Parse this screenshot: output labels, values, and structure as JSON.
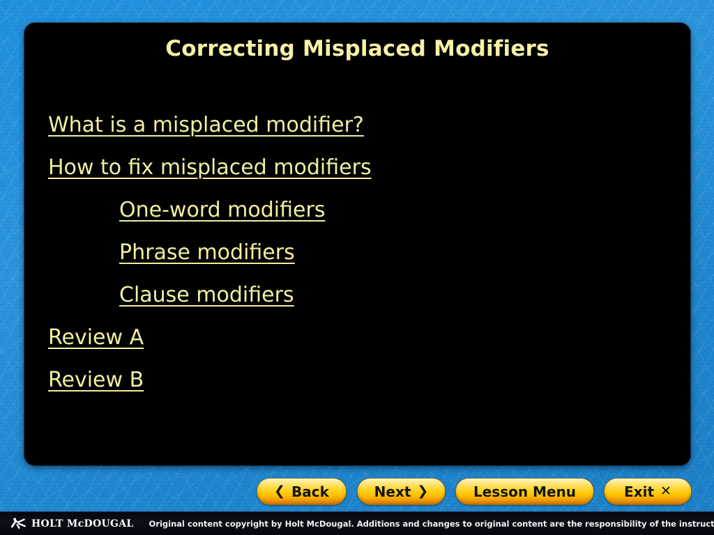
{
  "slide": {
    "title": "Correcting Misplaced Modifiers",
    "links": [
      {
        "label": "What is a misplaced modifier?",
        "indent": 0
      },
      {
        "label": "How to fix misplaced modifiers",
        "indent": 0
      },
      {
        "label": "One-word modifiers",
        "indent": 1
      },
      {
        "label": "Phrase modifiers",
        "indent": 1
      },
      {
        "label": "Clause modifiers",
        "indent": 1
      },
      {
        "label": "Review A",
        "indent": 0
      },
      {
        "label": "Review B",
        "indent": 0
      }
    ]
  },
  "nav": {
    "back": {
      "label": "Back",
      "glyph": "❮",
      "glyph_position": "before",
      "icon": "chevron-left-icon"
    },
    "next": {
      "label": "Next",
      "glyph": "❯",
      "glyph_position": "after",
      "icon": "chevron-right-icon"
    },
    "menu": {
      "label": "Lesson Menu",
      "glyph": "",
      "glyph_position": "none",
      "icon": ""
    },
    "exit": {
      "label": "Exit",
      "glyph": "✕",
      "glyph_position": "after",
      "icon": "close-x-icon"
    }
  },
  "footer": {
    "brand": "HOLT McDOUGAL",
    "copyright": "Original content copyright by Holt McDougal.  Additions and changes to original content are the responsibility of the instructor."
  },
  "colors": {
    "background_blue": "#2391da",
    "panel_black": "#000000",
    "title_yellow": "#f7f0a6",
    "link_yellow": "#f2efa0",
    "button_gold": "#ffd21f",
    "button_orange": "#e98a06",
    "footer_black": "#05070d"
  }
}
